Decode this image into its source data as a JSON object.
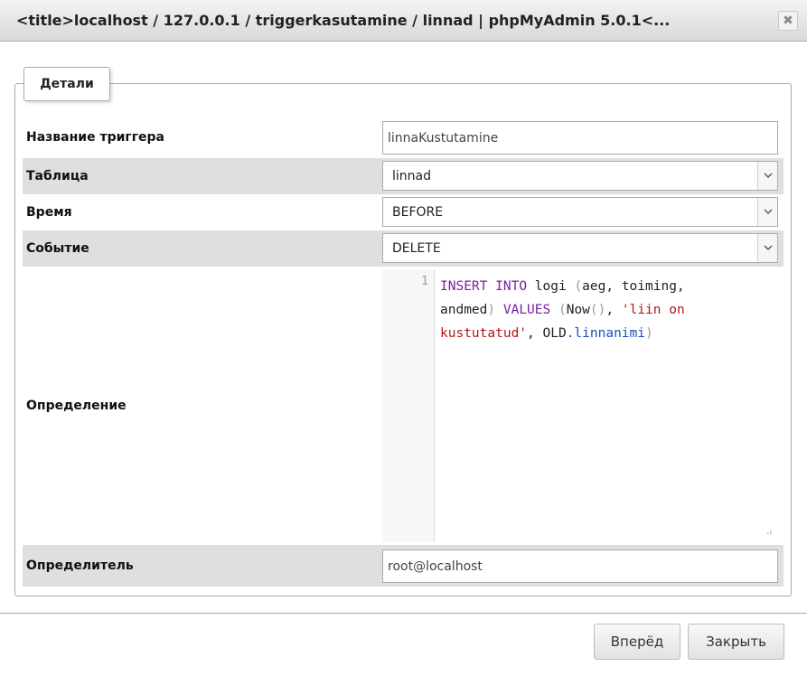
{
  "window": {
    "title": "<title>localhost / 127.0.0.1 / triggerkasutamine / linnad | phpMyAdmin 5.0.1<...",
    "close_glyph": "✖"
  },
  "fieldset": {
    "legend": "Детали"
  },
  "form": {
    "trigger_name": {
      "label": "Название триггера",
      "value": "linnaKustutamine"
    },
    "table": {
      "label": "Таблица",
      "selected": "linnad"
    },
    "time": {
      "label": "Время",
      "selected": "BEFORE"
    },
    "event": {
      "label": "Событие",
      "selected": "DELETE"
    },
    "definition": {
      "label": "Определение",
      "line_number": "1",
      "code_tokens": {
        "t1": "INSERT",
        "t2": " ",
        "t3": "INTO",
        "t4": " logi ",
        "t5": "(",
        "t6": "aeg, toiming,",
        "t7": "andmed",
        "t8": ")",
        "t9": " ",
        "t10": "VALUES",
        "t11": " ",
        "t12": "(",
        "t13": "Now",
        "t14": "()",
        "t15": ", ",
        "t16": "'liin on",
        "t17": "kustutatud'",
        "t18": ", OLD",
        "t19": ".linnanimi",
        "t20": ")"
      },
      "resize_glyph": "⠴"
    },
    "definer": {
      "label": "Определитель",
      "value": "root@localhost"
    }
  },
  "buttons": {
    "go": "Вперёд",
    "close": "Закрыть"
  },
  "colors": {
    "keyword": "#7a1fa2",
    "string": "#b01818",
    "variable": "#1f4fb8",
    "row_shade": "#dfdfdf"
  }
}
